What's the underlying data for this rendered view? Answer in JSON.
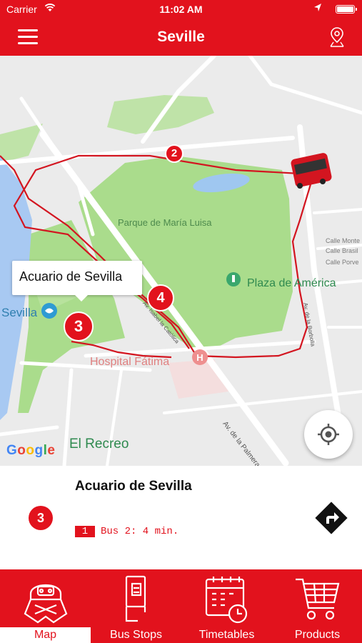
{
  "status_bar": {
    "carrier": "Carrier",
    "time": "11:02 AM"
  },
  "nav": {
    "title": "Seville",
    "menu_icon": "hamburger-menu-icon",
    "location_icon": "map-pin-icon"
  },
  "map": {
    "park_label": "Parque de María Luisa",
    "plaza_label": "Plaza de América",
    "hospital_label": "Hospital Fátima",
    "sevilla_label": "Sevilla",
    "recreo_label": "El Recreo",
    "palmera_label": "Av. de la Palmera",
    "borbolla_label": "Av. de la Borbolla",
    "isabel_label": "Av. Isabel la Católica",
    "street_labels": [
      "Calle Monte",
      "Calle Brasil",
      "Calle Porve"
    ],
    "google_logo": "Google",
    "callout_text": "Acuario de Sevilla",
    "stop_markers": [
      "2",
      "4",
      "3"
    ],
    "locate_icon": "locate-crosshair-icon"
  },
  "stop_panel": {
    "stop_name": "Acuario de Sevilla",
    "stop_number": "3",
    "line_number": "1",
    "arrival_text": "Bus 2: 4 min.",
    "directions_icon": "directions-arrow-icon"
  },
  "tabs": [
    {
      "label": "Map",
      "icon": "bus-guide-icon",
      "active": true
    },
    {
      "label": "Bus Stops",
      "icon": "bus-stop-icon",
      "active": false
    },
    {
      "label": "Timetables",
      "icon": "calendar-clock-icon",
      "active": false
    },
    {
      "label": "Products",
      "icon": "shopping-cart-icon",
      "active": false
    }
  ],
  "colors": {
    "brand_red": "#e2121d",
    "park_green": "#aadc8c",
    "water_blue": "#a8c9f2"
  }
}
